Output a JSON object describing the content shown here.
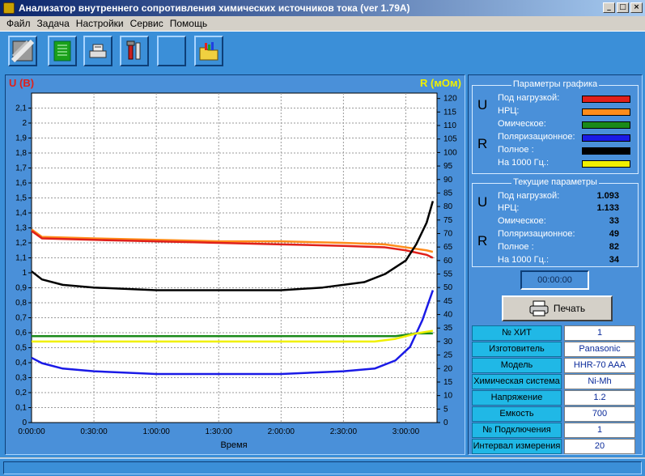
{
  "window": {
    "title": "Анализатор внутреннего сопротивления химических источников тока (ver 1.79A)",
    "min_glyph": "_",
    "max_glyph": "□",
    "close_glyph": "×"
  },
  "menu": [
    "Файл",
    "Задача",
    "Настройки",
    "Сервис",
    "Помощь"
  ],
  "toolbar": [
    {
      "icon": "battery-icon"
    },
    {
      "icon": "circuit-board-icon"
    },
    {
      "icon": "device-icon"
    },
    {
      "icon": "tools-icon"
    },
    {
      "icon": "blank-icon"
    },
    {
      "icon": "open-folder-chart-icon"
    }
  ],
  "chart_data": {
    "type": "line",
    "left_axis_label": "U (B)",
    "right_axis_label": "R (мОм)",
    "xlabel": "Время",
    "x_ticks": [
      "0:00:00",
      "0:30:00",
      "1:00:00",
      "1:30:00",
      "2:00:00",
      "2:30:00",
      "3:00:00"
    ],
    "x_minutes_range": [
      0,
      195
    ],
    "left_ylim": [
      0,
      2.2
    ],
    "left_ticks": [
      "0",
      "0,1",
      "0,2",
      "0,3",
      "0,4",
      "0,5",
      "0,6",
      "0,7",
      "0,8",
      "0,9",
      "1",
      "1,1",
      "1,2",
      "1,3",
      "1,4",
      "1,5",
      "1,6",
      "1,7",
      "1,8",
      "1,9",
      "2",
      "2,1"
    ],
    "right_ylim": [
      0,
      122
    ],
    "right_ticks": [
      "0",
      "5",
      "10",
      "15",
      "20",
      "25",
      "30",
      "35",
      "40",
      "45",
      "50",
      "55",
      "60",
      "65",
      "70",
      "75",
      "80",
      "85",
      "90",
      "95",
      "100",
      "105",
      "110",
      "115",
      "120"
    ],
    "grid": true,
    "series": [
      {
        "name": "НРЦ",
        "axis": "left",
        "color": "#ff8c1a",
        "x": [
          0,
          5,
          30,
          60,
          90,
          120,
          150,
          170,
          180,
          190,
          193
        ],
        "y": [
          1.29,
          1.24,
          1.23,
          1.22,
          1.21,
          1.21,
          1.2,
          1.19,
          1.17,
          1.15,
          1.14
        ]
      },
      {
        "name": "Под нагрузкой",
        "axis": "left",
        "color": "#e0201a",
        "x": [
          0,
          5,
          30,
          60,
          90,
          120,
          150,
          170,
          180,
          190,
          193
        ],
        "y": [
          1.28,
          1.23,
          1.22,
          1.21,
          1.2,
          1.19,
          1.18,
          1.17,
          1.15,
          1.12,
          1.1
        ]
      },
      {
        "name": "Полное",
        "axis": "right",
        "color": "#000000",
        "x": [
          0,
          5,
          15,
          30,
          60,
          90,
          120,
          140,
          160,
          170,
          180,
          185,
          190,
          193
        ],
        "y": [
          56,
          53,
          51,
          50,
          49,
          49,
          49,
          50,
          52,
          55,
          60,
          66,
          74,
          82
        ]
      },
      {
        "name": "Поляризационное",
        "axis": "right",
        "color": "#1a1ae6",
        "x": [
          0,
          5,
          15,
          30,
          60,
          90,
          120,
          150,
          165,
          175,
          182,
          188,
          193
        ],
        "y": [
          24,
          22,
          20,
          19,
          18,
          18,
          18,
          19,
          20,
          23,
          28,
          38,
          49
        ]
      },
      {
        "name": "Омическое",
        "axis": "right",
        "color": "#1a8a1a",
        "x": [
          0,
          60,
          120,
          165,
          175,
          185,
          193
        ],
        "y": [
          32,
          32,
          32,
          32,
          32,
          33,
          33
        ]
      },
      {
        "name": "На 1000 Гц.",
        "axis": "right",
        "color": "#f0f000",
        "x": [
          0,
          60,
          120,
          165,
          175,
          185,
          193
        ],
        "y": [
          30,
          30,
          30,
          30,
          31,
          33,
          34
        ]
      }
    ]
  },
  "graph_params": {
    "title": "Параметры графика",
    "u_letter": "U",
    "r_letter": "R",
    "items": [
      {
        "label": "Под нагрузкой:",
        "color": "#e0201a"
      },
      {
        "label": "НРЦ:",
        "color": "#ff8c1a"
      },
      {
        "label": "Омическое:",
        "color": "#1a8a1a"
      },
      {
        "label": "Поляризационное:",
        "color": "#1a1ae6"
      },
      {
        "label": "Полное :",
        "color": "#000000"
      },
      {
        "label": "На 1000 Гц.:",
        "color": "#f0f000"
      }
    ]
  },
  "current_params": {
    "title": "Текущие параметры",
    "u_letter": "U",
    "r_letter": "R",
    "items": [
      {
        "label": "Под нагрузкой:",
        "value": "1.093"
      },
      {
        "label": "НРЦ:",
        "value": "1.133"
      },
      {
        "label": "Омическое:",
        "value": "33"
      },
      {
        "label": "Поляризационное:",
        "value": "49"
      },
      {
        "label": "Полное :",
        "value": "82"
      },
      {
        "label": "На 1000 Гц.:",
        "value": "34"
      }
    ]
  },
  "timer": "00:00:00",
  "print_label": "Печать",
  "info": [
    {
      "key": "№ ХИТ",
      "value": "1"
    },
    {
      "key": "Изготовитель",
      "value": "Panasonic"
    },
    {
      "key": "Модель",
      "value": "HHR-70 AAA"
    },
    {
      "key": "Химическая система",
      "value": "Ni-Mh"
    },
    {
      "key": "Напряжение",
      "value": "1.2"
    },
    {
      "key": "Емкость",
      "value": "700"
    },
    {
      "key": "№ Подключения",
      "value": "1"
    },
    {
      "key": "Интервал измерения",
      "value": "20"
    }
  ]
}
